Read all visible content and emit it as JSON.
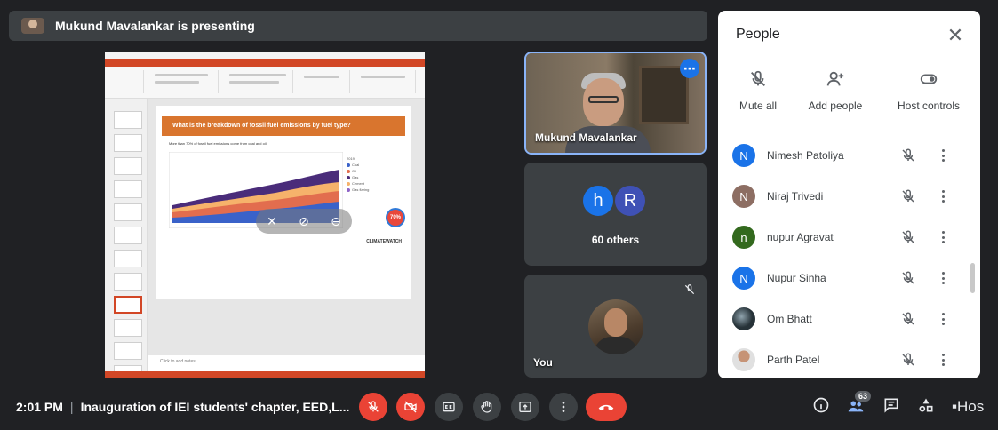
{
  "presenting": {
    "text": "Mukund Mavalankar is presenting"
  },
  "slide": {
    "heading": "What is the breakdown of fossil fuel emissions by fuel type?",
    "bullet": "More than 70% of fossil fuel emissions come from coal and oil.",
    "badge": "70%",
    "legend_title": "2019",
    "legend_items": [
      {
        "label": "Coal",
        "color": "#3a62c9"
      },
      {
        "label": "Oil",
        "color": "#e26d4e"
      },
      {
        "label": "Gas",
        "color": "#4a2c7a"
      },
      {
        "label": "Cement",
        "color": "#f6b26b"
      },
      {
        "label": "Gas flaring",
        "color": "#8e63c7"
      }
    ],
    "source": "CLIMATEWATCH",
    "notes": "Click to add notes"
  },
  "tiles": {
    "main_name": "Mukund Mavalankar",
    "others_label": "60 others",
    "others_avatars": [
      {
        "letter": "h",
        "color": "#1a73e8"
      },
      {
        "letter": "R",
        "color": "#3f51b5"
      }
    ],
    "you_label": "You"
  },
  "panel": {
    "title": "People",
    "actions": [
      {
        "label": "Mute all",
        "icon": "mic-off-icon"
      },
      {
        "label": "Add people",
        "icon": "add-person-icon"
      },
      {
        "label": "Host controls",
        "icon": "toggle-icon"
      }
    ],
    "participants": [
      {
        "name": "Nimesh Patoliya",
        "initial": "N",
        "color": "#1a73e8"
      },
      {
        "name": "Niraj Trivedi",
        "initial": "N",
        "color": "#8d6e63"
      },
      {
        "name": "nupur Agravat",
        "initial": "n",
        "color": "#33691e"
      },
      {
        "name": "Nupur Sinha",
        "initial": "N",
        "color": "#1a73e8"
      },
      {
        "name": "Om Bhatt",
        "initial": "",
        "color": "#263238"
      },
      {
        "name": "Parth Patel",
        "initial": "",
        "color": "#e0e0e0"
      }
    ]
  },
  "bottom": {
    "time": "2:01 PM",
    "meeting_title": "Inauguration of IEI students' chapter, EED,L...",
    "people_count": "63",
    "host_text": "Hos"
  },
  "colors": {
    "red": "#ea4335",
    "blue": "#1a73e8",
    "dark": "#202124",
    "tile": "#3c4043"
  }
}
